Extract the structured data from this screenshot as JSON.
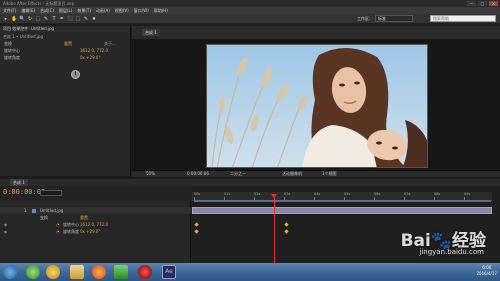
{
  "window": {
    "title": "Adobe After Effects - 无标题项目.aep",
    "controls": [
      "—",
      "□",
      "✕"
    ]
  },
  "menu": [
    "文件(F)",
    "编辑(E)",
    "合成(C)",
    "图层(L)",
    "效果(T)",
    "动画(A)",
    "视图(V)",
    "窗口(W)",
    "帮助(H)"
  ],
  "toolbar": {
    "tools": [
      "▸",
      "✋",
      "🔍",
      "↻",
      "⬚",
      "✎",
      "T",
      "✒",
      "⬛",
      "⬚",
      "✎",
      "★"
    ],
    "workspace_label": "工作区:",
    "workspace_value": "标准",
    "search_placeholder": "搜索帮助"
  },
  "left_panel": {
    "header": "项目  效果控件: Untitled.jpg",
    "breadcrumb": "合成 1 • Untitled.jpg",
    "effect_name": "变换",
    "reset_label": "重置",
    "about_label": "关于...",
    "properties": [
      {
        "label": "旋转中心",
        "value": "1612.0, 772.0"
      },
      {
        "label": "旋转角度",
        "value": "0x +29.0°"
      }
    ]
  },
  "composition": {
    "tab_label": "合成 1",
    "viewer_bar": {
      "zoom": "50%",
      "timecode": "0:00:00:06",
      "quality": "二分之一",
      "camera": "活动摄像机",
      "views": "1个视图"
    }
  },
  "timeline": {
    "tab_label": "合成 1",
    "timecode": "0:00:00:06",
    "layer_name": "Untitled.jpg",
    "layer_index": "1",
    "effect_row": "变换",
    "reset_label": "重置",
    "rows": [
      {
        "label": "旋转中心",
        "value": "1612.0, 772.0"
      },
      {
        "label": "旋转角度",
        "value": "0x +29.0°"
      }
    ],
    "ruler_labels": [
      "00s",
      "01s",
      "02s",
      "03s",
      "04s",
      "05s",
      "06s",
      "07s",
      "08s",
      "09s",
      "10s"
    ]
  },
  "taskbar": {
    "time": "6:06",
    "date": "2016/4/17"
  },
  "watermark": {
    "text": "Bai🐾经验",
    "subtext": "jingyan.baidu.com"
  }
}
